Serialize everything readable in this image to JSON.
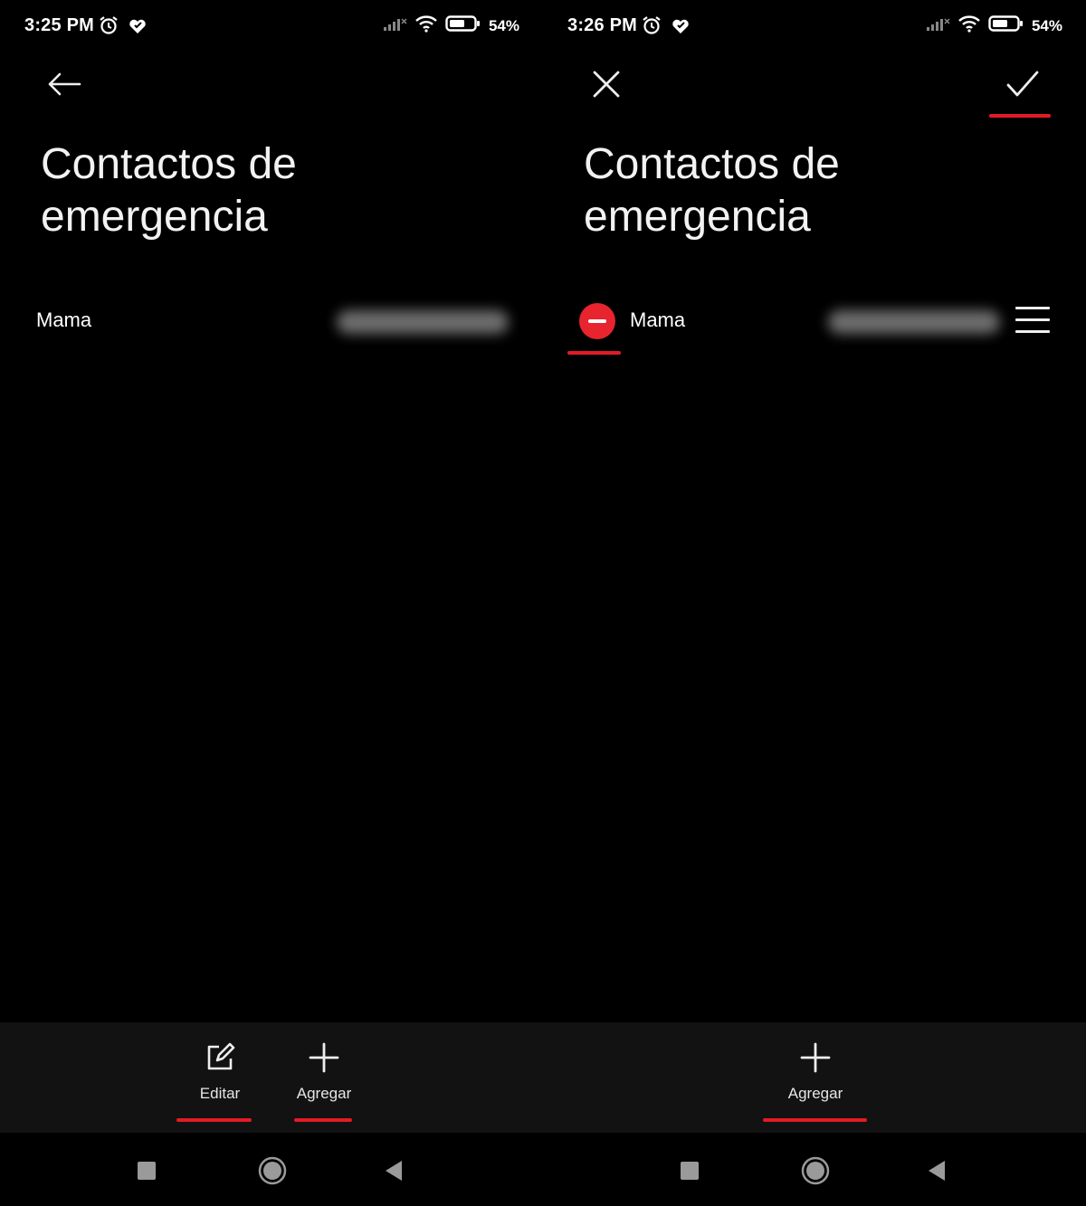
{
  "left": {
    "status": {
      "time": "3:25 PM",
      "battery": "54%"
    },
    "title": "Contactos de emergencia",
    "contact": {
      "name": "Mama"
    },
    "actions": {
      "edit_label": "Editar",
      "add_label": "Agregar"
    }
  },
  "right": {
    "status": {
      "time": "3:26 PM",
      "battery": "54%"
    },
    "title": "Contactos de emergencia",
    "contact": {
      "name": "Mama"
    },
    "actions": {
      "add_label": "Agregar"
    }
  },
  "colors": {
    "background": "#000000",
    "action_bar": "#121212",
    "accent_red": "#e21b26",
    "remove_red": "#e8242f",
    "text": "#ffffff"
  },
  "icons": {
    "status": [
      "alarm-icon",
      "heart-check-icon",
      "signal-icon",
      "wifi-icon",
      "battery-icon"
    ],
    "left_top": "back-arrow-icon",
    "right_top": [
      "close-icon",
      "checkmark-icon"
    ],
    "row": [
      "remove-circle-icon",
      "drag-handle-icon"
    ],
    "actions": [
      "edit-icon",
      "plus-icon"
    ],
    "nav": [
      "recents-square-icon",
      "home-circle-icon",
      "back-triangle-icon"
    ]
  }
}
